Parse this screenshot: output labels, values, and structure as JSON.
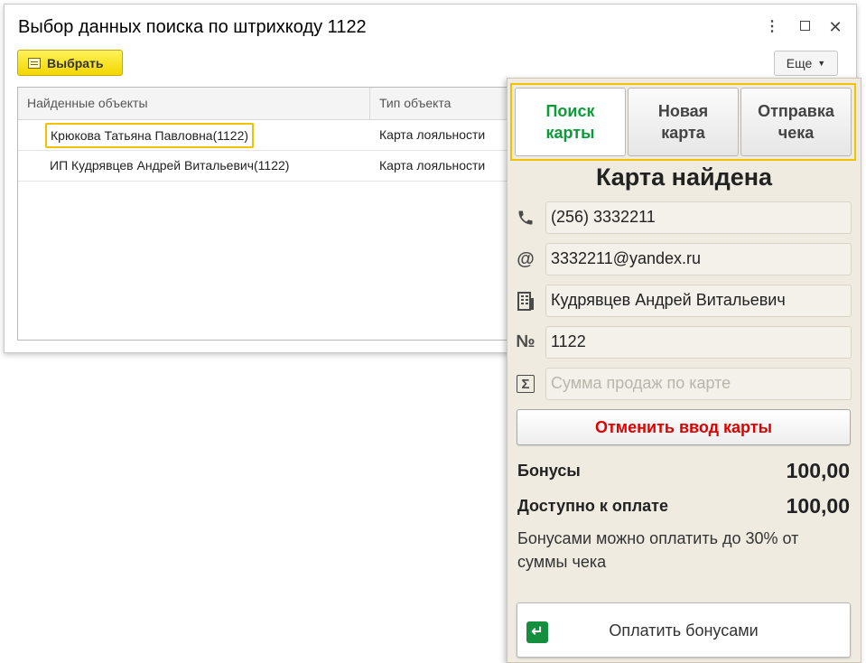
{
  "dialog": {
    "title": "Выбор данных поиска по штрихкоду 1122",
    "window_buttons": {
      "menu": "⋮",
      "maximize": "",
      "close": "✕"
    },
    "select_label": "Выбрать",
    "more_label": "Еще",
    "table": {
      "columns": [
        "Найденные объекты",
        "Тип объекта"
      ],
      "rows": [
        [
          "Крюкова Татьяна Павловна(1122)",
          "Карта лояльности"
        ],
        [
          "ИП Кудрявцев Андрей Витальевич(1122)",
          "Карта лояльности"
        ]
      ]
    }
  },
  "panel": {
    "tabs": [
      "Поиск\nкарты",
      "Новая\nкарта",
      "Отправка\nчека"
    ],
    "active_tab": 0,
    "heading": "Карта найдена",
    "fields": {
      "phone": {
        "icon": "phone-icon",
        "value": "(256) 3332211"
      },
      "email": {
        "icon": "at-icon",
        "value": "3332211@yandex.ru"
      },
      "owner": {
        "icon": "building-icon",
        "value": "Кудрявцев Андрей Витальевич"
      },
      "number": {
        "icon": "number-sign-icon",
        "glyph": "№",
        "value": "1122"
      },
      "sales": {
        "icon": "sigma-icon",
        "glyph": "Σ",
        "placeholder": "Сумма продаж по карте"
      }
    },
    "cancel_label": "Отменить ввод карты",
    "bonuses_label": "Бонусы",
    "bonuses_value": "100,00",
    "available_label": "Доступно к оплате",
    "available_value": "100,00",
    "note": "Бонусами можно оплатить до 30% от суммы чека",
    "pay_label": "Оплатить бонусами",
    "colors": {
      "active_tab": "#0d9b3a",
      "cancel_text": "#e00000",
      "highlight": "#f0c200",
      "pay_icon": "#138f3d"
    }
  }
}
